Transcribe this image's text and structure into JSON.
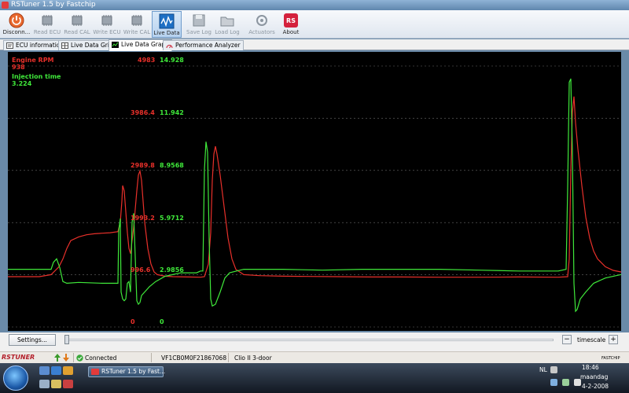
{
  "window": {
    "title": "RSTuner 1.5 by Fastchip"
  },
  "toolbar": {
    "buttons": [
      {
        "label": "Disconn...",
        "icon": "disconnect-icon"
      },
      {
        "label": "Read ECU",
        "icon": "chip-icon"
      },
      {
        "label": "Read CAL",
        "icon": "chip-icon"
      },
      {
        "label": "Write ECU",
        "icon": "chip-icon"
      },
      {
        "label": "Write CAL",
        "icon": "chip-icon"
      },
      {
        "label": "Live Data",
        "icon": "live-data-icon"
      },
      {
        "label": "Save Log",
        "icon": "save-icon"
      },
      {
        "label": "Load Log",
        "icon": "load-icon"
      },
      {
        "label": "Actuators",
        "icon": "actuator-icon"
      },
      {
        "label": "About",
        "icon": "rs-logo-icon"
      }
    ]
  },
  "tabs": [
    {
      "label": "ECU information"
    },
    {
      "label": "Live Data Grid"
    },
    {
      "label": "Live Data Graph"
    },
    {
      "label": "Performance Analyzer"
    }
  ],
  "signals": [
    {
      "name": "Engine RPM",
      "value": "938",
      "color": "#e8302a"
    },
    {
      "name": "Injection time",
      "value": "3.224",
      "color": "#3fe83a"
    }
  ],
  "axis": {
    "rpm_ticks": [
      "4983",
      "3986.4",
      "2989.8",
      "1993.2",
      "996.6",
      "0"
    ],
    "inj_ticks": [
      "14.928",
      "11.942",
      "8.9568",
      "5.9712",
      "2.9856",
      "0"
    ]
  },
  "chart_data": {
    "type": "line",
    "y_rpm_range": [
      0,
      4983
    ],
    "y_inj_range": [
      0,
      14.928
    ],
    "grid": true,
    "series": [
      {
        "name": "Engine RPM",
        "color": "#e8302a",
        "points": [
          [
            0,
            960
          ],
          [
            20,
            960
          ],
          [
            40,
            960
          ],
          [
            55,
            1000
          ],
          [
            65,
            1150
          ],
          [
            70,
            1300
          ],
          [
            75,
            1500
          ],
          [
            80,
            1650
          ],
          [
            90,
            1720
          ],
          [
            100,
            1760
          ],
          [
            110,
            1780
          ],
          [
            120,
            1790
          ],
          [
            130,
            1800
          ],
          [
            140,
            1820
          ],
          [
            143,
            2000
          ],
          [
            145,
            2400
          ],
          [
            146,
            2700
          ],
          [
            148,
            2600
          ],
          [
            150,
            2200
          ],
          [
            152,
            1800
          ],
          [
            154,
            1500
          ],
          [
            156,
            1400
          ],
          [
            158,
            1650
          ],
          [
            160,
            1900
          ],
          [
            164,
            2600
          ],
          [
            166,
            2900
          ],
          [
            168,
            2980
          ],
          [
            170,
            2800
          ],
          [
            172,
            2400
          ],
          [
            174,
            2000
          ],
          [
            178,
            1500
          ],
          [
            182,
            1200
          ],
          [
            186,
            1050
          ],
          [
            190,
            1000
          ],
          [
            200,
            970
          ],
          [
            210,
            960
          ],
          [
            230,
            955
          ],
          [
            245,
            950
          ],
          [
            250,
            960
          ],
          [
            255,
            1200
          ],
          [
            258,
            1800
          ],
          [
            260,
            2800
          ],
          [
            262,
            3300
          ],
          [
            264,
            3450
          ],
          [
            266,
            3300
          ],
          [
            270,
            2900
          ],
          [
            275,
            2300
          ],
          [
            280,
            1700
          ],
          [
            285,
            1300
          ],
          [
            290,
            1100
          ],
          [
            300,
            1000
          ],
          [
            320,
            980
          ],
          [
            350,
            970
          ],
          [
            380,
            965
          ],
          [
            420,
            960
          ],
          [
            460,
            955
          ],
          [
            500,
            955
          ],
          [
            550,
            950
          ],
          [
            600,
            950
          ],
          [
            650,
            955
          ],
          [
            700,
            950
          ],
          [
            712,
            960
          ],
          [
            714,
            1300
          ],
          [
            716,
            3000
          ],
          [
            718,
            4100
          ],
          [
            720,
            4400
          ],
          [
            722,
            3900
          ],
          [
            725,
            3400
          ],
          [
            730,
            2700
          ],
          [
            735,
            2100
          ],
          [
            740,
            1700
          ],
          [
            745,
            1450
          ],
          [
            750,
            1300
          ],
          [
            760,
            1150
          ],
          [
            770,
            1080
          ],
          [
            780,
            1050
          ]
        ]
      },
      {
        "name": "Injection time",
        "color": "#3fe83a",
        "points": [
          [
            0,
            3.3
          ],
          [
            30,
            3.3
          ],
          [
            55,
            3.3
          ],
          [
            58,
            3.7
          ],
          [
            62,
            3.9
          ],
          [
            66,
            3.4
          ],
          [
            70,
            2.6
          ],
          [
            75,
            2.5
          ],
          [
            90,
            2.55
          ],
          [
            120,
            2.5
          ],
          [
            140,
            2.5
          ],
          [
            141,
            5.5
          ],
          [
            143,
            6.2
          ],
          [
            144,
            2.0
          ],
          [
            146,
            1.6
          ],
          [
            148,
            1.5
          ],
          [
            150,
            1.6
          ],
          [
            152,
            2.5
          ],
          [
            154,
            2.6
          ],
          [
            156,
            2.0
          ],
          [
            158,
            6.0
          ],
          [
            160,
            6.5
          ],
          [
            162,
            4.0
          ],
          [
            164,
            1.5
          ],
          [
            166,
            1.3
          ],
          [
            168,
            1.4
          ],
          [
            170,
            1.8
          ],
          [
            174,
            2.0
          ],
          [
            180,
            2.3
          ],
          [
            188,
            2.6
          ],
          [
            200,
            2.9
          ],
          [
            220,
            3.1
          ],
          [
            240,
            3.1
          ],
          [
            245,
            3.2
          ],
          [
            248,
            3.2
          ],
          [
            250,
            9.0
          ],
          [
            252,
            10.6
          ],
          [
            254,
            10.0
          ],
          [
            256,
            5.0
          ],
          [
            258,
            1.6
          ],
          [
            260,
            1.2
          ],
          [
            264,
            1.3
          ],
          [
            270,
            2.0
          ],
          [
            276,
            2.8
          ],
          [
            282,
            3.1
          ],
          [
            300,
            3.3
          ],
          [
            350,
            3.3
          ],
          [
            400,
            3.25
          ],
          [
            450,
            3.3
          ],
          [
            500,
            3.3
          ],
          [
            550,
            3.3
          ],
          [
            600,
            3.25
          ],
          [
            650,
            3.2
          ],
          [
            700,
            3.2
          ],
          [
            710,
            3.3
          ],
          [
            712,
            8.0
          ],
          [
            714,
            14.0
          ],
          [
            716,
            14.2
          ],
          [
            718,
            10.0
          ],
          [
            720,
            2.5
          ],
          [
            722,
            0.9
          ],
          [
            724,
            1.0
          ],
          [
            728,
            1.6
          ],
          [
            735,
            2.0
          ],
          [
            745,
            2.5
          ],
          [
            760,
            2.8
          ],
          [
            780,
            3.0
          ]
        ]
      }
    ]
  },
  "controls": {
    "settings_label": "Settings...",
    "minus_label": "−",
    "plus_label": "+",
    "timescale_label": "timescale"
  },
  "status": {
    "logo": "RSTUNER",
    "connection": "Connected",
    "vin": "VF1CB0M0F21867068",
    "vehicle": "Clio II 3-door",
    "vendor": "FASTCHIP"
  },
  "taskbar": {
    "task_label": "RSTuner 1.5 by Fast...",
    "language": "NL",
    "time": "18:46",
    "day": "maandag",
    "date": "4-2-2008"
  }
}
